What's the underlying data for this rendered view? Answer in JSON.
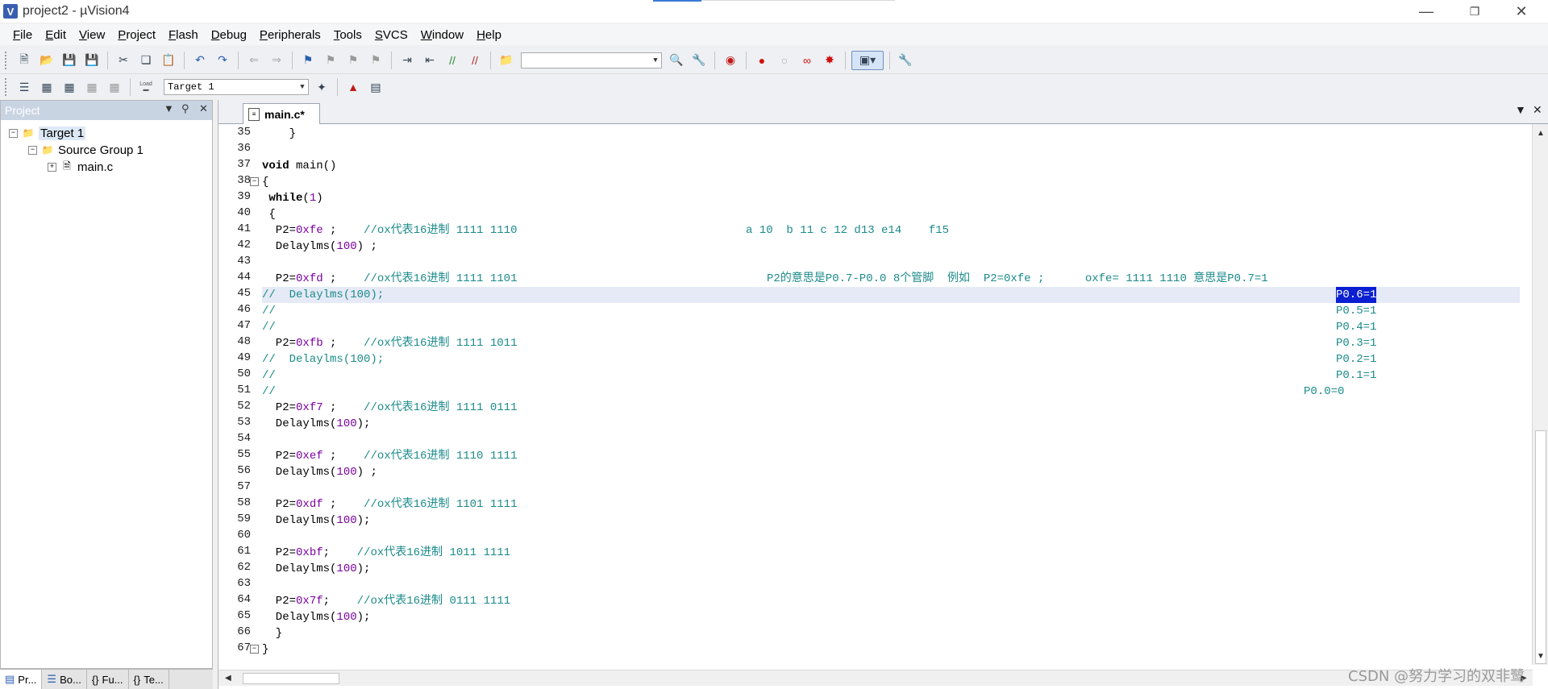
{
  "window": {
    "title": "project2 - µVision4",
    "minimize": "—",
    "restore": "❐",
    "close": "✕"
  },
  "menu": [
    "File",
    "Edit",
    "View",
    "Project",
    "Flash",
    "Debug",
    "Peripherals",
    "Tools",
    "SVCS",
    "Window",
    "Help"
  ],
  "toolbar2": {
    "target_value": "Target 1",
    "load_label": "Load"
  },
  "project_pane": {
    "header": "Project",
    "tree": [
      {
        "label": "Target 1",
        "level": 0,
        "expander": "−"
      },
      {
        "label": "Source Group 1",
        "level": 1,
        "expander": "−"
      },
      {
        "label": "main.c",
        "level": 2,
        "expander": "+"
      }
    ],
    "bottom_tabs": [
      "Pr...",
      "Bo...",
      "Fu...",
      "Te..."
    ]
  },
  "editor": {
    "tab_label": "main.c*",
    "lines": [
      {
        "n": 35,
        "text": "    }"
      },
      {
        "n": 36,
        "text": ""
      },
      {
        "n": 37,
        "text": "void main()"
      },
      {
        "n": 38,
        "text": "{",
        "fold": "−"
      },
      {
        "n": 39,
        "text": " while(1)"
      },
      {
        "n": 40,
        "text": " {"
      },
      {
        "n": 41,
        "text": "  P2=0xfe ;    //ox代表16进制 1111 1110",
        "extra": "a 10  b 11 c 12 d13 e14    f15"
      },
      {
        "n": 42,
        "text": "  Delaylms(100) ;"
      },
      {
        "n": 43,
        "text": ""
      },
      {
        "n": 44,
        "text": "  P2=0xfd ;    //ox代表16进制 1111 1101",
        "extra": "P2的意思是P0.7-P0.0 8个管脚  例如  P2=0xfe ;      oxfe= 1111 1110 意思是P0.7=1"
      },
      {
        "n": 45,
        "text": "//  Delaylms(100);",
        "right": "P0.6=1",
        "highlight": true
      },
      {
        "n": 46,
        "text": "//",
        "right": "P0.5=1"
      },
      {
        "n": 47,
        "text": "//",
        "right": "P0.4=1"
      },
      {
        "n": 48,
        "text": "  P2=0xfb ;    //ox代表16进制 1111 1011",
        "right": "P0.3=1"
      },
      {
        "n": 49,
        "text": "//  Delaylms(100);",
        "right": "P0.2=1"
      },
      {
        "n": 50,
        "text": "//",
        "right": "P0.1=1"
      },
      {
        "n": 51,
        "text": "//",
        "right2": "P0.0=0"
      },
      {
        "n": 52,
        "text": "  P2=0xf7 ;    //ox代表16进制 1111 0111"
      },
      {
        "n": 53,
        "text": "  Delaylms(100);"
      },
      {
        "n": 54,
        "text": ""
      },
      {
        "n": 55,
        "text": "  P2=0xef ;    //ox代表16进制 1110 1111"
      },
      {
        "n": 56,
        "text": "  Delaylms(100) ;"
      },
      {
        "n": 57,
        "text": ""
      },
      {
        "n": 58,
        "text": "  P2=0xdf ;    //ox代表16进制 1101 1111"
      },
      {
        "n": 59,
        "text": "  Delaylms(100);"
      },
      {
        "n": 60,
        "text": ""
      },
      {
        "n": 61,
        "text": "  P2=0xbf;    //ox代表16进制 1011 1111"
      },
      {
        "n": 62,
        "text": "  Delaylms(100);"
      },
      {
        "n": 63,
        "text": ""
      },
      {
        "n": 64,
        "text": "  P2=0x7f;    //ox代表16进制 0111 1111"
      },
      {
        "n": 65,
        "text": "  Delaylms(100);"
      },
      {
        "n": 66,
        "text": "  }"
      },
      {
        "n": 67,
        "text": "}",
        "fold": "−"
      }
    ]
  },
  "watermark": "CSDN @努力学习的双非鹭",
  "colors": {
    "comment": "#1c8a8a",
    "number": "#7a00a0",
    "selection": "#0b1fd1",
    "current_line": "#e5eaf6"
  }
}
